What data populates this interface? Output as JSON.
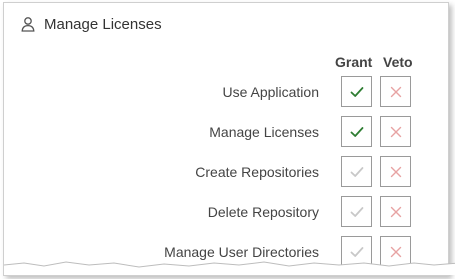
{
  "header": {
    "title": "Manage Licenses",
    "icon": "user-icon"
  },
  "columns": {
    "grant": "Grant",
    "veto": "Veto"
  },
  "colors": {
    "check_on": "#2e7d32",
    "check_off": "#c8c8c8",
    "x_mark": "#e7a3a3"
  },
  "rows": [
    {
      "label": "Use Application",
      "grant": true,
      "veto": false
    },
    {
      "label": "Manage Licenses",
      "grant": true,
      "veto": false
    },
    {
      "label": "Create Repositories",
      "grant": false,
      "veto": false
    },
    {
      "label": "Delete Repository",
      "grant": false,
      "veto": false
    },
    {
      "label": "Manage User Directories",
      "grant": false,
      "veto": false
    }
  ]
}
